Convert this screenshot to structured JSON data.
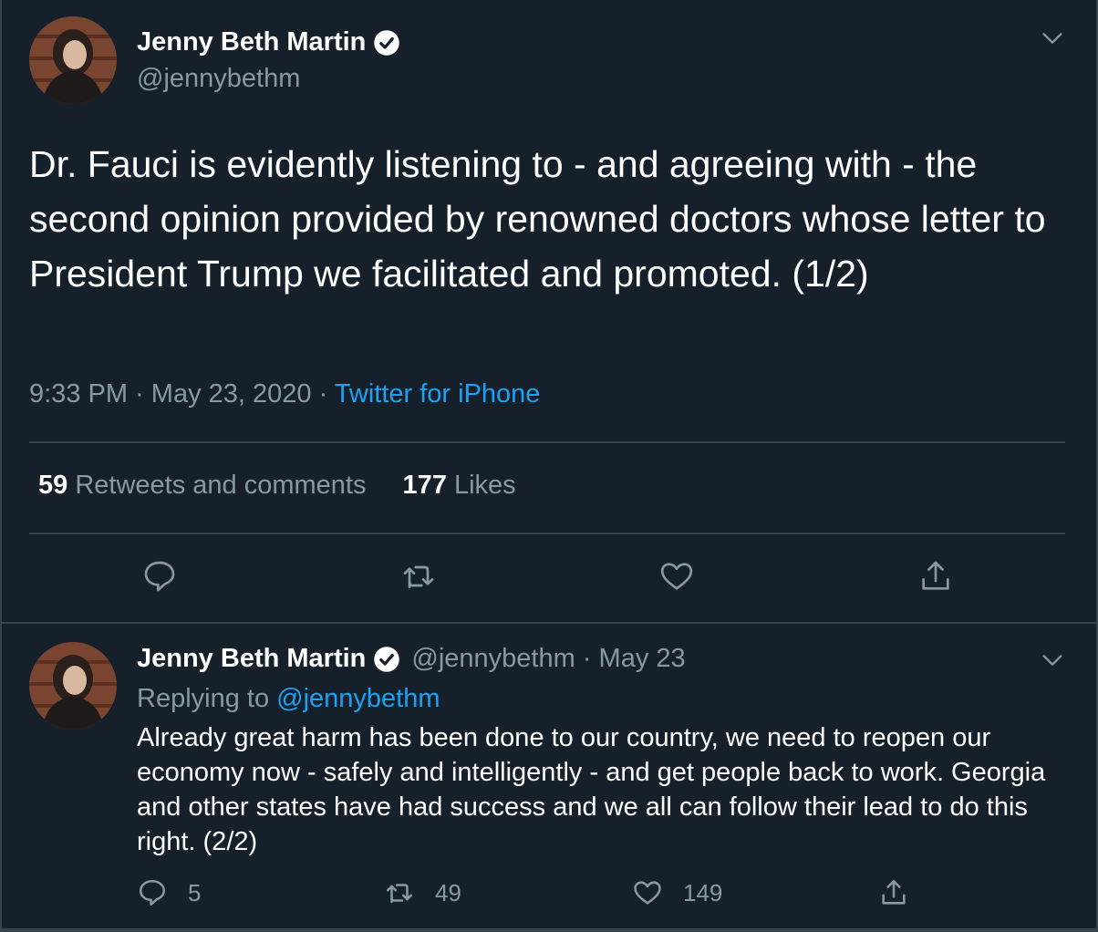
{
  "tweet": {
    "author_name": "Jenny Beth Martin",
    "author_handle": "@jennybethm",
    "text": "Dr. Fauci is evidently listening to - and agreeing with - the second opinion provided by renowned doctors whose letter to President Trump we facilitated and promoted. (1/2)",
    "time": "9:33 PM",
    "date": "May 23, 2020",
    "source": "Twitter for iPhone",
    "retweets_count": "59",
    "retweets_label": "Retweets and comments",
    "likes_count": "177",
    "likes_label": "Likes"
  },
  "reply": {
    "author_name": "Jenny Beth Martin",
    "author_handle": "@jennybethm",
    "date": "May 23",
    "replying_label": "Replying to",
    "replying_to": "@jennybethm",
    "text": "Already great harm has been done to our country, we need to reopen our economy now - safely and intelligently - and get people back to work. Georgia and other states have had success and we all can follow their lead to do this right. (2/2)",
    "reply_count": "5",
    "retweet_count": "49",
    "like_count": "149"
  },
  "colors": {
    "background": "#15202b",
    "muted": "#8899a6",
    "link": "#1da1f2",
    "border": "#38444d"
  },
  "icons": [
    "verified-badge-icon",
    "chevron-down-icon",
    "reply-icon",
    "retweet-icon",
    "like-icon",
    "share-icon"
  ]
}
